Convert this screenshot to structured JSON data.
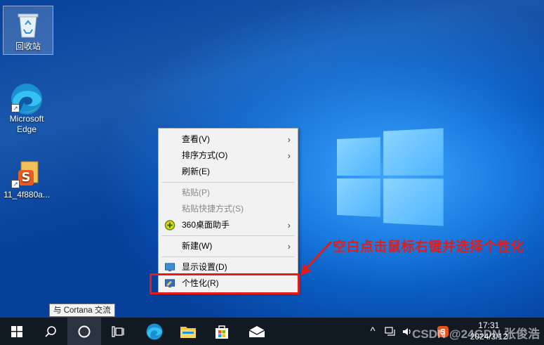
{
  "desktop_icons": [
    {
      "label": "回收站",
      "icon": "recycle-bin-icon"
    },
    {
      "label": "Microsoft Edge",
      "icon": "edge-icon"
    },
    {
      "label": "11_4f880a...",
      "icon": "installer-icon"
    }
  ],
  "context_menu": {
    "view": "查看(V)",
    "sort": "排序方式(O)",
    "refresh": "刷新(E)",
    "paste": "粘贴(P)",
    "paste_shortcut": "粘贴快捷方式(S)",
    "desk_assistant": "360桌面助手",
    "new": "新建(W)",
    "display": "显示设置(D)",
    "personalize": "个性化(R)"
  },
  "annotation": "空白点击鼠标右键并选择个性化",
  "tooltip": "与 Cortana 交流",
  "taskbar": {
    "clock_time": "17:31",
    "clock_date": "2024/3/12",
    "tray_chevron": "^"
  },
  "watermark": "CSDN @24GDN 张俊浩",
  "colors": {
    "accent_red": "#e21b1b",
    "taskbar_bg": "#111a22"
  }
}
